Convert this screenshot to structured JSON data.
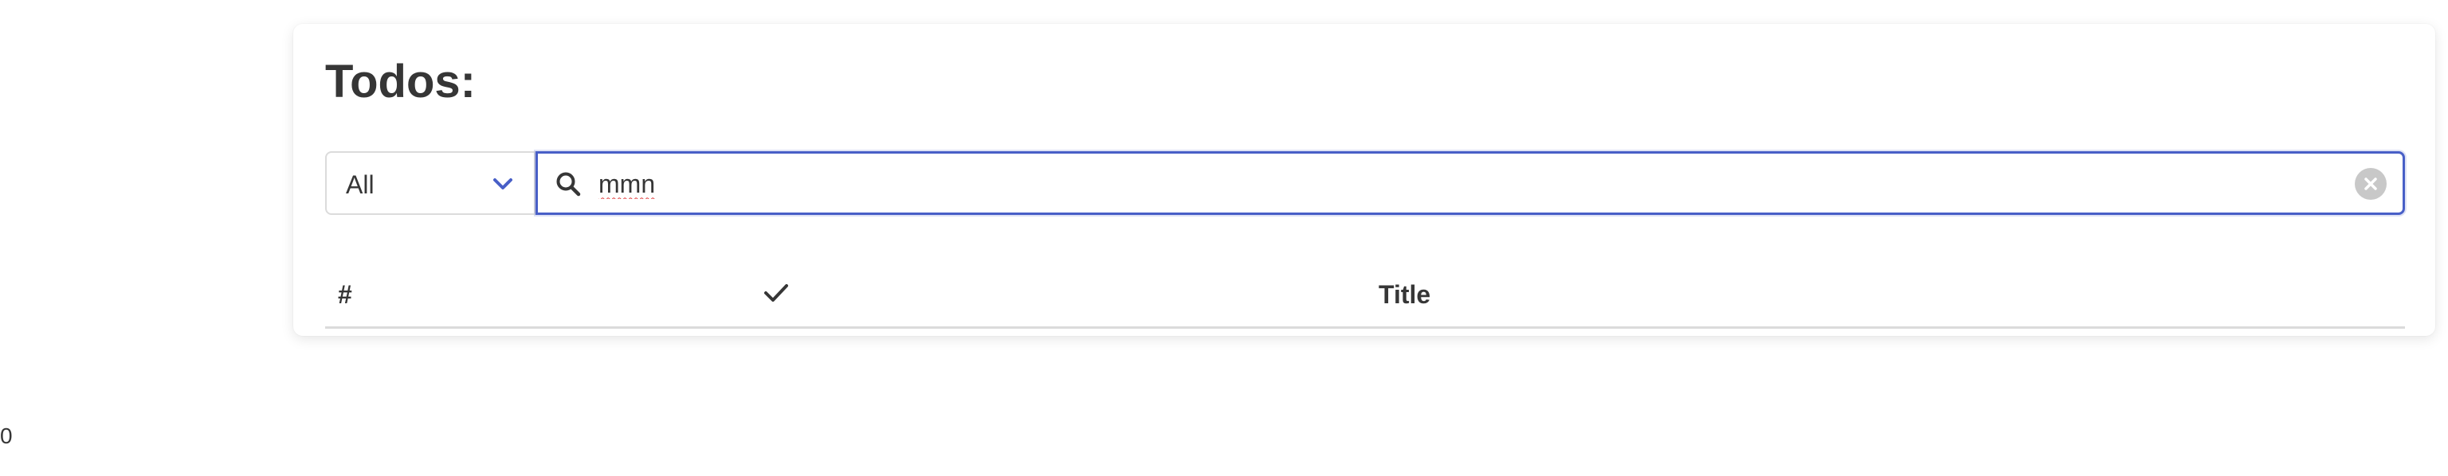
{
  "page": {
    "title": "Todos:"
  },
  "filter": {
    "selected": "All",
    "icon": "chevron-down-icon"
  },
  "search": {
    "value": "mmn",
    "icon": "search-icon",
    "clear_icon": "close-icon"
  },
  "table": {
    "columns": {
      "index": "#",
      "completed_icon": "check-icon",
      "title": "Title"
    },
    "rows": []
  },
  "footer": {
    "counter": "0"
  },
  "colors": {
    "accent": "#485fc7",
    "text": "#363636",
    "border": "#dbdbdb",
    "clear_button": "#c8c8c8",
    "spellcheck": "#e03c3c"
  }
}
